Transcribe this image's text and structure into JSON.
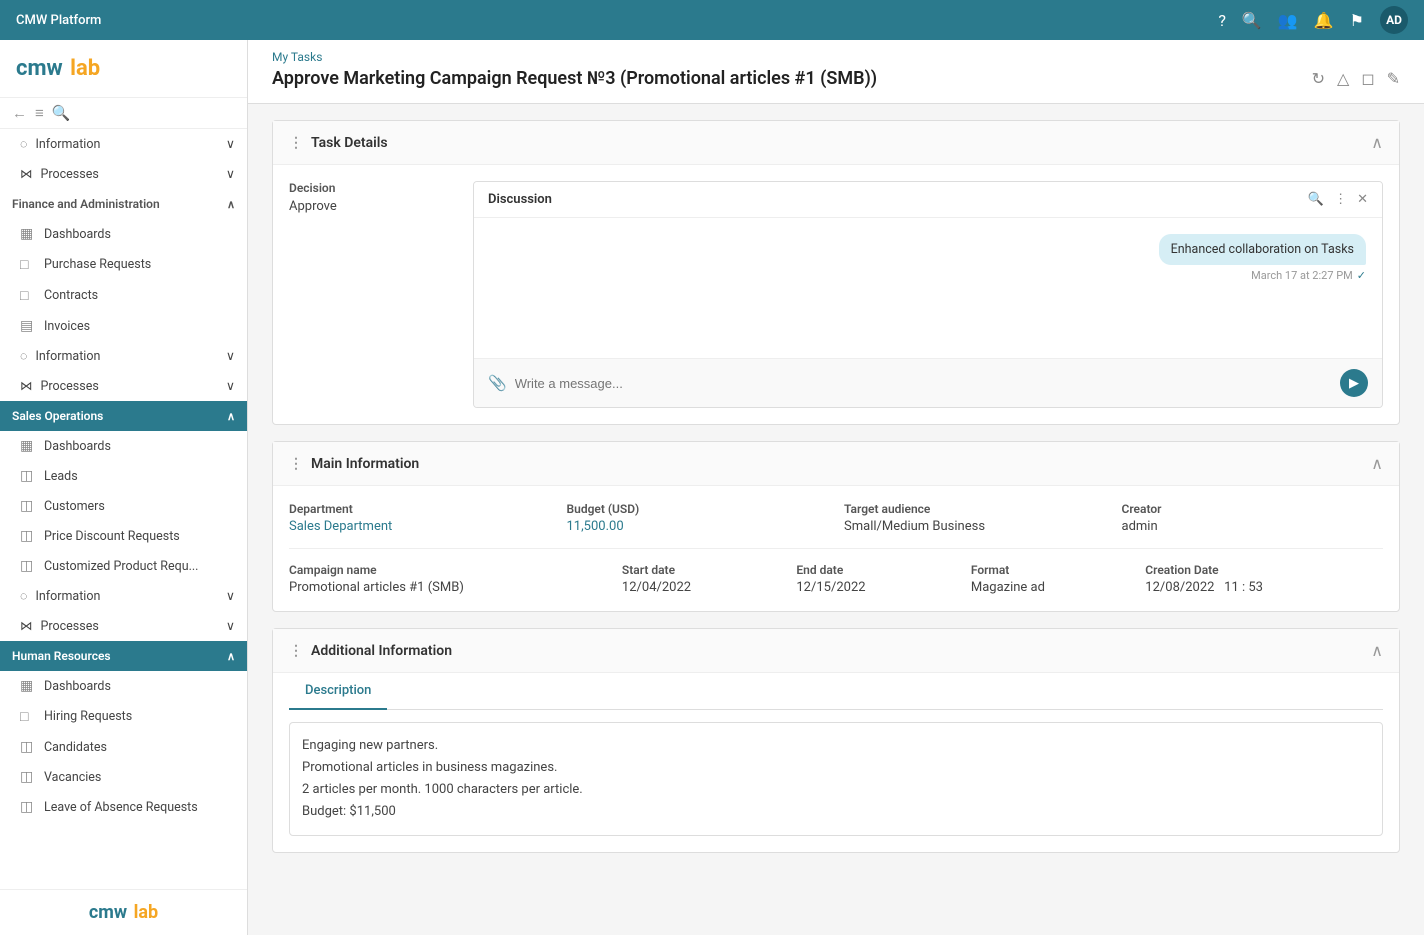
{
  "topbar": {
    "title": "CMW Platform",
    "avatar": "AD"
  },
  "sidebar": {
    "logo_cmw": "cmw",
    "logo_lab": "lab",
    "sections": [
      {
        "id": "finance",
        "label": "Finance and Administration",
        "active": false,
        "items": [
          {
            "id": "dashboards-fin",
            "label": "Dashboards",
            "icon": "▦"
          },
          {
            "id": "purchase-requests",
            "label": "Purchase Requests",
            "icon": "□"
          },
          {
            "id": "contracts",
            "label": "Contracts",
            "icon": "□"
          },
          {
            "id": "invoices",
            "label": "Invoices",
            "icon": "▤"
          },
          {
            "id": "information-fin",
            "label": "Information",
            "icon": "◌",
            "expandable": true
          },
          {
            "id": "processes-fin",
            "label": "Processes",
            "icon": "⋈",
            "expandable": true
          }
        ]
      },
      {
        "id": "sales",
        "label": "Sales Operations",
        "active": true,
        "items": [
          {
            "id": "dashboards-sales",
            "label": "Dashboards",
            "icon": "▦"
          },
          {
            "id": "leads",
            "label": "Leads",
            "icon": "◫"
          },
          {
            "id": "customers",
            "label": "Customers",
            "icon": "◫"
          },
          {
            "id": "price-discount",
            "label": "Price Discount Requests",
            "icon": "◫"
          },
          {
            "id": "customized-product",
            "label": "Customized Product Requ...",
            "icon": "◫"
          },
          {
            "id": "information-sales",
            "label": "Information",
            "icon": "◌",
            "expandable": true
          },
          {
            "id": "processes-sales",
            "label": "Processes",
            "icon": "⋈",
            "expandable": true
          }
        ]
      },
      {
        "id": "hr",
        "label": "Human Resources",
        "active": true,
        "items": [
          {
            "id": "dashboards-hr",
            "label": "Dashboards",
            "icon": "▦"
          },
          {
            "id": "hiring-requests",
            "label": "Hiring Requests",
            "icon": "□"
          },
          {
            "id": "candidates",
            "label": "Candidates",
            "icon": "◫"
          },
          {
            "id": "vacancies",
            "label": "Vacancies",
            "icon": "◫"
          },
          {
            "id": "leave-requests",
            "label": "Leave of Absence Requests",
            "icon": "◫"
          }
        ]
      }
    ],
    "bottom_logo_cmw": "cmw",
    "bottom_logo_lab": "lab"
  },
  "header": {
    "breadcrumb": "My Tasks",
    "title": "Approve Marketing Campaign Request №3 (Promotional articles #1 (SMB))",
    "actions": [
      "↻",
      "△",
      "◻",
      "✎"
    ]
  },
  "task_details": {
    "section_title": "Task Details",
    "decision_label": "Decision",
    "decision_value": "Approve",
    "discussion": {
      "title": "Discussion",
      "message": "Enhanced collaboration on Tasks",
      "message_time": "March 17 at 2:27 PM",
      "input_placeholder": "Write a message..."
    }
  },
  "main_information": {
    "section_title": "Main Information",
    "fields_row1": [
      {
        "label": "Department",
        "value": "Sales Department",
        "link": true
      },
      {
        "label": "Budget (USD)",
        "value": "11,500.00",
        "link": true
      },
      {
        "label": "Target audience",
        "value": "Small/Medium Business",
        "link": false
      },
      {
        "label": "Creator",
        "value": "admin",
        "link": false
      }
    ],
    "fields_row2": [
      {
        "label": "Campaign name",
        "value": "Promotional articles #1 (SMB)",
        "link": false
      },
      {
        "label": "Start date",
        "value": "12/04/2022",
        "link": false
      },
      {
        "label": "End date",
        "value": "12/15/2022",
        "link": false
      },
      {
        "label": "Format",
        "value": "Magazine ad",
        "link": false
      },
      {
        "label": "Creation Date",
        "value": "12/08/2022   11 : 53",
        "link": false
      }
    ]
  },
  "additional_information": {
    "section_title": "Additional Information",
    "tabs": [
      "Description"
    ],
    "active_tab": "Description",
    "description": "Engaging new partners.\nPromotional articles in business magazines.\n2 articles per month. 1000 characters per article.\nBudget: $11,500"
  }
}
